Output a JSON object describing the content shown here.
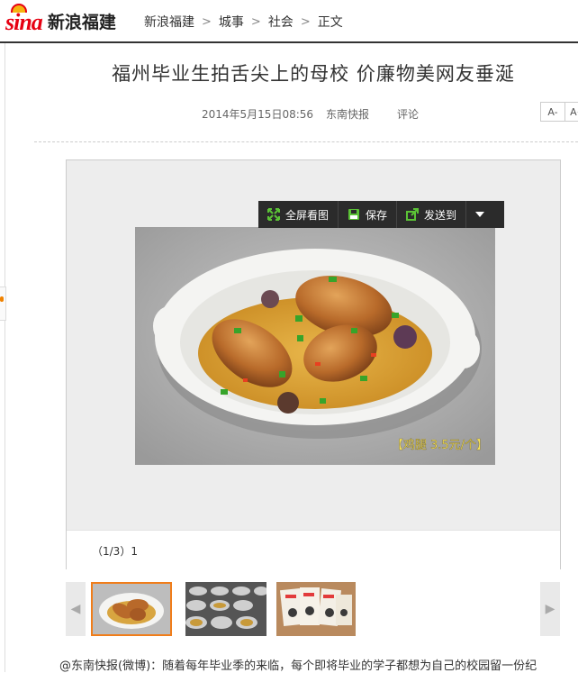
{
  "header": {
    "logo_text": "sina",
    "site_name": "新浪福建",
    "breadcrumbs": [
      "新浪福建",
      "城事",
      "社会",
      "正文"
    ]
  },
  "article": {
    "title": "福州毕业生拍舌尖上的母校 价廉物美网友垂涎",
    "datetime": "2014年5月15日08:56",
    "source": "东南快报",
    "comments_label": "评论",
    "font_decrease": "A-",
    "font_increase": "A+"
  },
  "gallery": {
    "toolbar": {
      "fullscreen_label": "全屏看图",
      "save_label": "保存",
      "sendto_label": "发送到"
    },
    "photo_overlay_text": "【鸡腿 3.5元/个】",
    "caption": "（1/3）1",
    "thumbnails": [
      {
        "icon": "chicken-dish",
        "active": true
      },
      {
        "icon": "canteen-trays",
        "active": false
      },
      {
        "icon": "menu-cards",
        "active": false
      }
    ]
  },
  "body": {
    "source_link": "@东南快报(微博)",
    "text": "：随着每年毕业季的来临，每个即将毕业的学子都想为自己的校园留一份纪"
  },
  "colors": {
    "brand_red": "#e60012",
    "thumb_active": "#f07d1a",
    "toolbar_bg": "#2b2b2b"
  }
}
